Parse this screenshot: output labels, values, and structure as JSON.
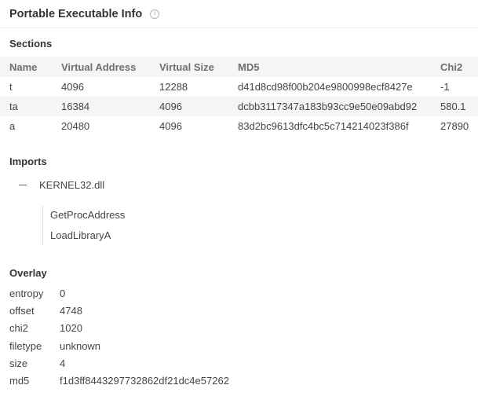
{
  "header": {
    "title": "Portable Executable Info",
    "info_icon": "info-icon"
  },
  "sections": {
    "title": "Sections",
    "columns": [
      "Name",
      "Virtual Address",
      "Virtual Size",
      "MD5",
      "Chi2"
    ],
    "rows": [
      {
        "name": "t",
        "virtual_address": "4096",
        "virtual_size": "12288",
        "md5": "d41d8cd98f00b204e9800998ecf8427e",
        "chi2": "-1"
      },
      {
        "name": "ta",
        "virtual_address": "16384",
        "virtual_size": "4096",
        "md5": "dcbb3117347a183b93cc9e50e09abd92",
        "chi2": "580.1"
      },
      {
        "name": "a",
        "virtual_address": "20480",
        "virtual_size": "4096",
        "md5": "83d2bc9613dfc4bc5c714214023f386f",
        "chi2": "27890"
      }
    ]
  },
  "imports": {
    "title": "Imports",
    "dll": "KERNEL32.dll",
    "functions": [
      "GetProcAddress",
      "LoadLibraryA"
    ]
  },
  "overlay": {
    "title": "Overlay",
    "entries": [
      {
        "key": "entropy",
        "value": "0"
      },
      {
        "key": "offset",
        "value": "4748"
      },
      {
        "key": "chi2",
        "value": "1020"
      },
      {
        "key": "filetype",
        "value": "unknown"
      },
      {
        "key": "size",
        "value": "4"
      },
      {
        "key": "md5",
        "value": "f1d3ff8443297732862df21dc4e57262"
      }
    ]
  }
}
